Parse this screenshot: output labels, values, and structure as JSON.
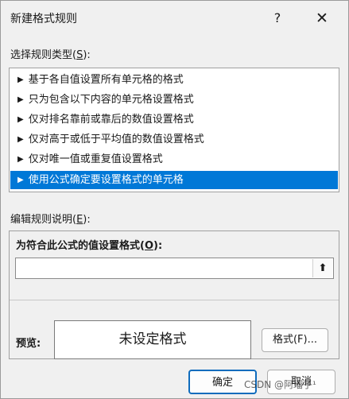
{
  "dialog": {
    "title": "新建格式规则",
    "help_label": "?",
    "close_label": "✕"
  },
  "rule_type": {
    "label_prefix": "选择规则类型(",
    "label_key": "S",
    "label_suffix": "):",
    "selected_index": 5,
    "items": [
      {
        "arrow": "▶",
        "label": "基于各自值设置所有单元格的格式"
      },
      {
        "arrow": "▶",
        "label": "只为包含以下内容的单元格设置格式"
      },
      {
        "arrow": "▶",
        "label": "仅对排名靠前或靠后的数值设置格式"
      },
      {
        "arrow": "▶",
        "label": "仅对高于或低于平均值的数值设置格式"
      },
      {
        "arrow": "▶",
        "label": "仅对唯一值或重复值设置格式"
      },
      {
        "arrow": "▶",
        "label": "使用公式确定要设置格式的单元格"
      }
    ]
  },
  "edit_rule": {
    "label_prefix": "编辑规则说明(",
    "label_key": "E",
    "label_suffix": "):",
    "formula_heading_prefix": "为符合此公式的值设置格式(",
    "formula_heading_key": "O",
    "formula_heading_suffix": "):",
    "formula_value": "",
    "collapse_icon": "⬆",
    "preview_label": "预览:",
    "preview_text": "未设定格式",
    "format_button": "格式(F)..."
  },
  "buttons": {
    "ok": "确定",
    "cancel": "取消"
  },
  "watermark": "CSDN @阿瑠子¹",
  "colors": {
    "selection": "#0078d7",
    "dialog_bg": "#f0f0f0",
    "default_button_border": "#0f6cbd"
  }
}
